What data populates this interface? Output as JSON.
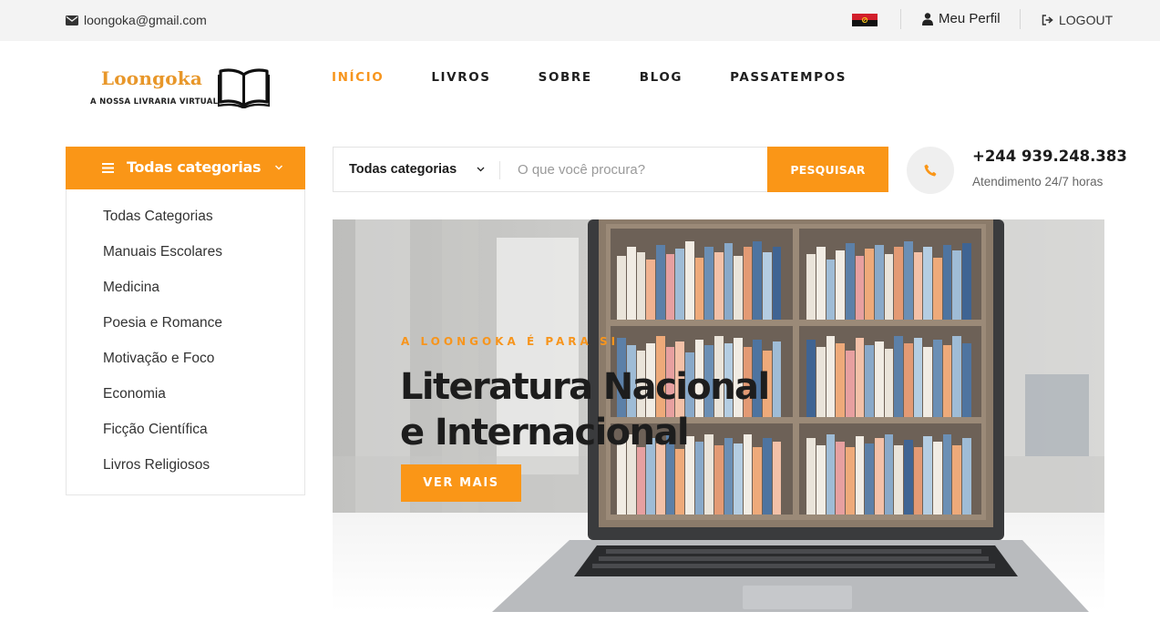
{
  "topbar": {
    "email": "loongoka@gmail.com",
    "profile_label": "Meu Perfil",
    "logout_label": "LOGOUT"
  },
  "logo": {
    "name": "Loongoka",
    "tagline": "A NOSSA LIVRARIA VIRTUAL"
  },
  "nav": {
    "items": [
      {
        "label": "INÍCIO",
        "active": true
      },
      {
        "label": "LIVROS"
      },
      {
        "label": "SOBRE"
      },
      {
        "label": "BLOG"
      },
      {
        "label": "PASSATEMPOS"
      }
    ]
  },
  "categories": {
    "header": "Todas categorias",
    "items": [
      "Todas Categorias",
      "Manuais Escolares",
      "Medicina",
      "Poesia e Romance",
      "Motivação e Foco",
      "Economia",
      "Ficção Científica",
      "Livros Religiosos"
    ]
  },
  "search": {
    "category_selected": "Todas categorias",
    "placeholder": "O que você procura?",
    "value": "",
    "button_label": "PESQUISAR"
  },
  "contact": {
    "phone": "+244 939.248.383",
    "subtitle": "Atendimento 24/7 horas"
  },
  "hero": {
    "kicker": "A LOONGOKA É PARA SI",
    "title_line1": "Literatura Nacional",
    "title_line2": "e Internacional",
    "cta_label": "VER MAIS"
  },
  "colors": {
    "accent": "#fa9617",
    "topbar_bg": "#f3f3f3",
    "text_dark": "#1c1c1c"
  },
  "icons": {
    "email": "envelope-icon",
    "flag": "angola-flag-icon",
    "profile": "user-icon",
    "logout": "logout-icon",
    "menu": "hamburger-menu-icon",
    "chevron": "chevron-down-icon",
    "phone": "phone-icon",
    "logo": "open-book-icon"
  }
}
